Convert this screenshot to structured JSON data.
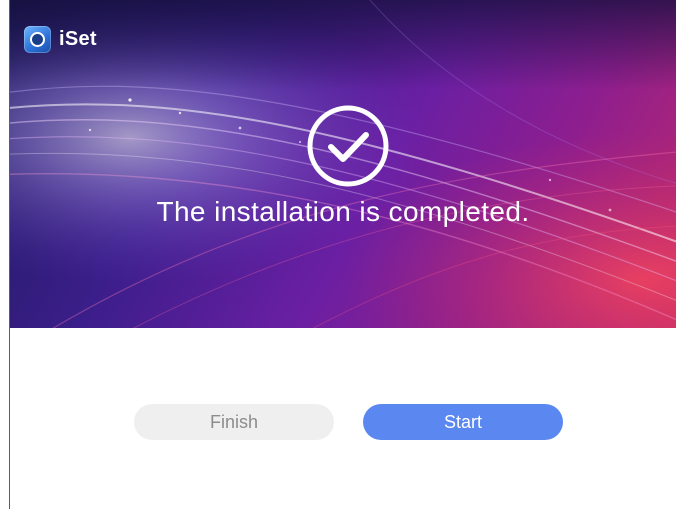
{
  "app": {
    "name": "iSet",
    "logo_icon": "iset-logo-icon"
  },
  "hero": {
    "status_icon": "check-circle-icon",
    "message": "The installation is completed."
  },
  "actions": {
    "finish_label": "Finish",
    "start_label": "Start"
  },
  "colors": {
    "accent": "#5b87f0",
    "secondary_button": "#efefef",
    "secondary_text": "#8c8c8c"
  }
}
